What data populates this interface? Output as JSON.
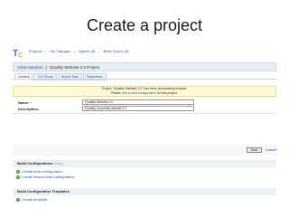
{
  "slide": {
    "title": "Create a project"
  },
  "nav": {
    "items": [
      {
        "label": "Projects"
      },
      {
        "label": "My Changes"
      },
      {
        "label": "Agents (6)"
      },
      {
        "label": "Build Queue (0)"
      }
    ]
  },
  "breadcrumb": {
    "root": "Administration",
    "separator": "|",
    "project": "tQuality Website 2.0 Project"
  },
  "tabs": [
    {
      "label": "General"
    },
    {
      "label": "VCS Roots"
    },
    {
      "label": "Report Tabs"
    },
    {
      "label": "Parameters"
    }
  ],
  "message": {
    "line1": "Project \"tQuality Website 2.0\" has been successfully created.",
    "line2_prefix": "Please",
    "line2_link": "add a build configuration",
    "line2_suffix": "for this project."
  },
  "form": {
    "name_label": "Name:",
    "required_mark": "*",
    "name_value": "tQuality Website 2.0",
    "description_label": "Description:",
    "description_value": "tQuality corporate website 2.0"
  },
  "actions": {
    "save": "Save",
    "cancel": "Cancel"
  },
  "build_configurations": {
    "heading": "Build Configurations",
    "hint": "(show)",
    "links": [
      {
        "label": "Create build configuration"
      },
      {
        "label": "Create Maven build configuration"
      }
    ]
  },
  "templates": {
    "heading": "Build Configuration Templates",
    "links": [
      {
        "label": "Create template"
      }
    ]
  },
  "colors": {
    "link": "#2255aa",
    "message_bg": "#fffbd6",
    "add_icon": "#3a9d3a"
  }
}
